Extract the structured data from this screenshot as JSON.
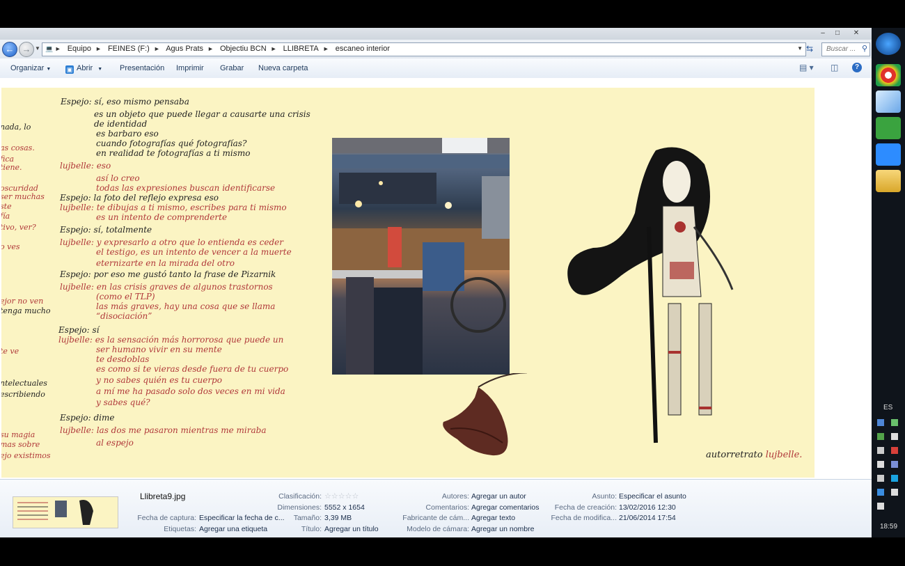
{
  "address": {
    "crumbs": [
      "Equipo",
      "FEINES (F:)",
      "Agus Prats",
      "Objectiu BCN",
      "LLIBRETA",
      "escaneo interior"
    ],
    "search_placeholder": "Buscar ..."
  },
  "toolbar": {
    "organize": "Organizar",
    "open": "Abrir",
    "slideshow": "Presentación",
    "print": "Imprimir",
    "burn": "Grabar",
    "new_folder": "Nueva carpeta"
  },
  "scan_notes": {
    "lines": [
      {
        "t": "Espejo: sí, eso mismo pensaba",
        "c": "blk"
      },
      {
        "t": "es un objeto que puede llegar a causarte una crisis",
        "c": "blk"
      },
      {
        "t": "de identidad",
        "c": "blk"
      },
      {
        "t": "es barbaro eso",
        "c": "blk"
      },
      {
        "t": "cuando fotografías qué fotografías?",
        "c": "blk"
      },
      {
        "t": "en realidad te fotografías a ti mismo",
        "c": "blk"
      },
      {
        "t": "lujbelle: eso",
        "c": "red"
      },
      {
        "t": "así lo creo",
        "c": "red"
      },
      {
        "t": "todas las expresiones buscan identificarse",
        "c": "red"
      },
      {
        "t": "Espejo: la foto del reflejo expresa eso",
        "c": "blk"
      },
      {
        "t": "lujbelle: te dibujas a ti mismo, escribes para ti mismo",
        "c": "red"
      },
      {
        "t": "es un intento de comprenderte",
        "c": "red"
      },
      {
        "t": "Espejo: sí, totalmente",
        "c": "blk"
      },
      {
        "t": "lujbelle: y expresarlo a otro que lo entienda es ceder",
        "c": "red"
      },
      {
        "t": "el testigo, es un intento de vencer a la muerte",
        "c": "red"
      },
      {
        "t": "eternizarte en la mirada del otro",
        "c": "red"
      },
      {
        "t": "Espejo: por eso me gustó tanto la frase de Pizarnik",
        "c": "blk"
      },
      {
        "t": "lujbelle: en las crisis graves de algunos trastornos",
        "c": "red"
      },
      {
        "t": "(como el TLP)",
        "c": "red"
      },
      {
        "t": "las más graves, hay una cosa que se llama",
        "c": "red"
      },
      {
        "t": "“disociación”",
        "c": "red"
      },
      {
        "t": "Espejo: sí",
        "c": "blk"
      },
      {
        "t": "lujbelle: es la sensación más horrorosa que puede un",
        "c": "red"
      },
      {
        "t": "ser humano vivir en su mente",
        "c": "red"
      },
      {
        "t": "te desdoblas",
        "c": "red"
      },
      {
        "t": "es como si te vieras desde fuera de tu cuerpo",
        "c": "red"
      },
      {
        "t": "y no sabes quién es tu cuerpo",
        "c": "red"
      },
      {
        "t": "a mí me ha pasado solo dos veces en mi vida",
        "c": "red"
      },
      {
        "t": "y sabes qué?",
        "c": "red"
      },
      {
        "t": "Espejo: dime",
        "c": "blk"
      },
      {
        "t": "lujbelle: las dos me pasaron mientras me miraba",
        "c": "red"
      },
      {
        "t": "al espejo",
        "c": "red"
      }
    ],
    "margin": [
      {
        "t": "nada, lo",
        "c": "blk"
      },
      {
        "t": "as cosas.",
        "c": "red"
      },
      {
        "t": "fica",
        "c": "red"
      },
      {
        "t": "tiene.",
        "c": "red"
      },
      {
        "t": "oscuridad",
        "c": "red"
      },
      {
        "t": "ser muchas",
        "c": "red"
      },
      {
        "t": "ste",
        "c": "red"
      },
      {
        "t": "fía",
        "c": "red"
      },
      {
        "t": "tivo, ver?",
        "c": "red"
      },
      {
        "t": "o ves",
        "c": "red"
      },
      {
        "t": "ejor no ven",
        "c": "red"
      },
      {
        "t": "tenga mucho",
        "c": "blk"
      },
      {
        "t": "te ve",
        "c": "red"
      },
      {
        "t": "ntelectuales",
        "c": "blk"
      },
      {
        "t": "escribiendo",
        "c": "blk"
      },
      {
        "t": "su magia",
        "c": "red"
      },
      {
        "t": "mas sobre",
        "c": "red"
      },
      {
        "t": "ejo existimos",
        "c": "red"
      }
    ],
    "signature_black": "autorretrato",
    "signature_red": "lujbelle."
  },
  "details": {
    "filename": "Llibreta9.jpg",
    "rows": [
      {
        "label": "Clasificación:",
        "value": ""
      },
      {
        "label": "Dimensiones:",
        "value": "5552 x 1654"
      },
      {
        "label": "Tamaño:",
        "value": "3,39 MB"
      },
      {
        "label": "Título:",
        "value": "Agregar un título"
      }
    ],
    "left": [
      {
        "label": "Fecha de captura:",
        "value": "Especificar la fecha de c..."
      },
      {
        "label": "Etiquetas:",
        "value": "Agregar una etiqueta"
      }
    ],
    "mid": [
      {
        "label": "Autores:",
        "value": "Agregar un autor"
      },
      {
        "label": "Comentarios:",
        "value": "Agregar comentarios"
      },
      {
        "label": "Fabricante de cám...",
        "value": "Agregar texto"
      },
      {
        "label": "Modelo de cámara:",
        "value": "Agregar un nombre"
      }
    ],
    "right": [
      {
        "label": "Asunto:",
        "value": "Especificar el asunto"
      },
      {
        "label": "Fecha de creación:",
        "value": "13/02/2016 12:30"
      },
      {
        "label": "Fecha de modifica...",
        "value": "21/06/2014 17:54"
      }
    ]
  },
  "taskbar": {
    "lang": "ES",
    "clock": "18:59"
  }
}
